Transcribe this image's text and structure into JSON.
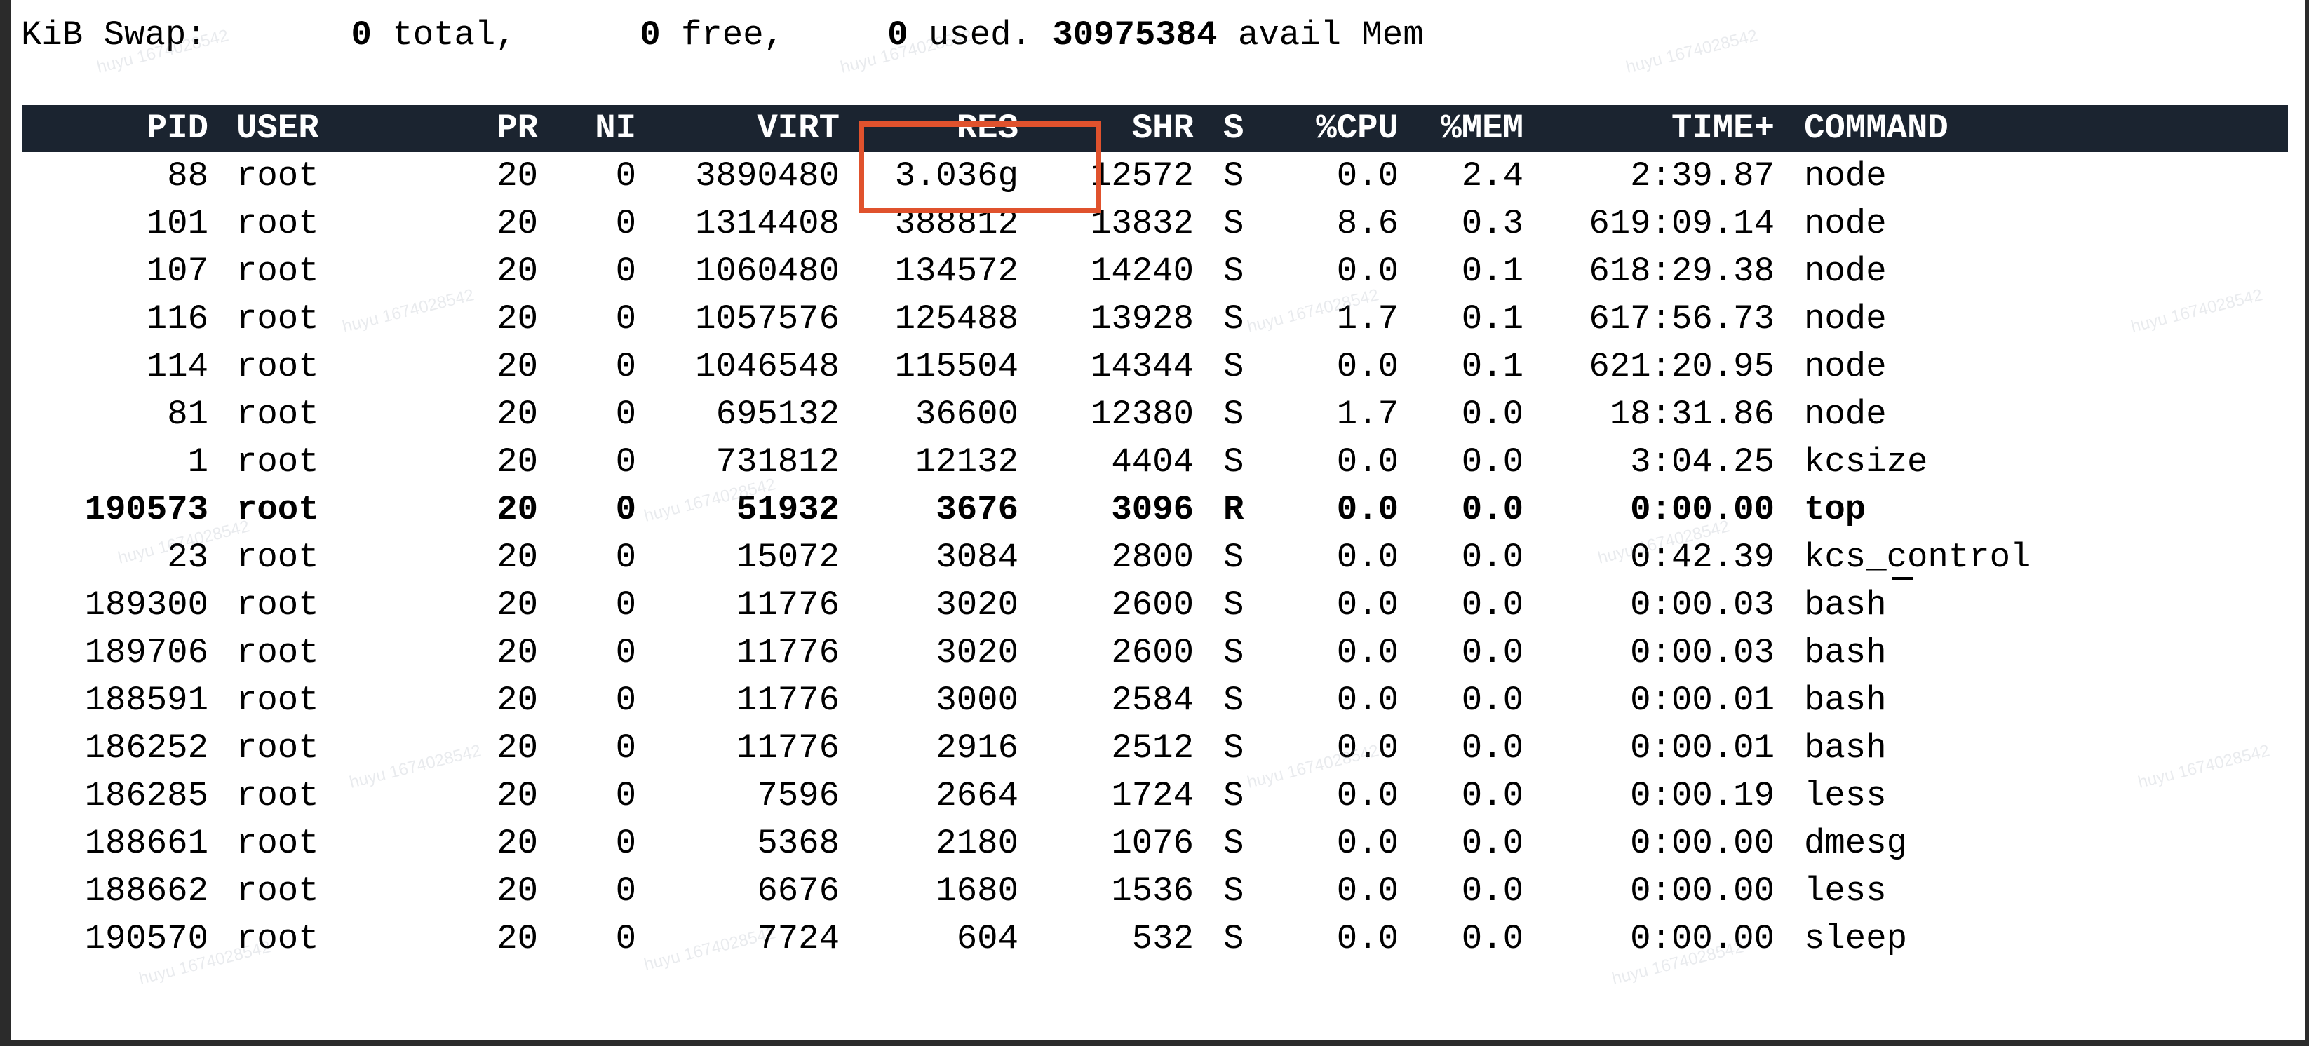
{
  "swap_line": {
    "label": "KiB Swap:",
    "total_value": "0",
    "total_label": "total,",
    "free_value": "0",
    "free_label": "free,",
    "used_value": "0",
    "used_label": "used.",
    "avail_value": "30975384",
    "avail_label": "avail Mem"
  },
  "table": {
    "headers": [
      "PID",
      "USER",
      "PR",
      "NI",
      "VIRT",
      "RES",
      "SHR",
      "S",
      "%CPU",
      "%MEM",
      "TIME+",
      "COMMAND"
    ],
    "rows": [
      [
        "88",
        "root",
        "20",
        "0",
        "3890480",
        "3.036g",
        "12572",
        "S",
        "0.0",
        "2.4",
        "2:39.87",
        "node"
      ],
      [
        "101",
        "root",
        "20",
        "0",
        "1314408",
        "388812",
        "13832",
        "S",
        "8.6",
        "0.3",
        "619:09.14",
        "node"
      ],
      [
        "107",
        "root",
        "20",
        "0",
        "1060480",
        "134572",
        "14240",
        "S",
        "0.0",
        "0.1",
        "618:29.38",
        "node"
      ],
      [
        "116",
        "root",
        "20",
        "0",
        "1057576",
        "125488",
        "13928",
        "S",
        "1.7",
        "0.1",
        "617:56.73",
        "node"
      ],
      [
        "114",
        "root",
        "20",
        "0",
        "1046548",
        "115504",
        "14344",
        "S",
        "0.0",
        "0.1",
        "621:20.95",
        "node"
      ],
      [
        "81",
        "root",
        "20",
        "0",
        "695132",
        "36600",
        "12380",
        "S",
        "1.7",
        "0.0",
        "18:31.86",
        "node"
      ],
      [
        "1",
        "root",
        "20",
        "0",
        "731812",
        "12132",
        "4404",
        "S",
        "0.0",
        "0.0",
        "3:04.25",
        "kcsize"
      ],
      [
        "190573",
        "root",
        "20",
        "0",
        "51932",
        "3676",
        "3096",
        "R",
        "0.0",
        "0.0",
        "0:00.00",
        "top"
      ],
      [
        "23",
        "root",
        "20",
        "0",
        "15072",
        "3084",
        "2800",
        "S",
        "0.0",
        "0.0",
        "0:42.39",
        "kcs_control"
      ],
      [
        "189300",
        "root",
        "20",
        "0",
        "11776",
        "3020",
        "2600",
        "S",
        "0.0",
        "0.0",
        "0:00.03",
        "bash"
      ],
      [
        "189706",
        "root",
        "20",
        "0",
        "11776",
        "3020",
        "2600",
        "S",
        "0.0",
        "0.0",
        "0:00.03",
        "bash"
      ],
      [
        "188591",
        "root",
        "20",
        "0",
        "11776",
        "3000",
        "2584",
        "S",
        "0.0",
        "0.0",
        "0:00.01",
        "bash"
      ],
      [
        "186252",
        "root",
        "20",
        "0",
        "11776",
        "2916",
        "2512",
        "S",
        "0.0",
        "0.0",
        "0:00.01",
        "bash"
      ],
      [
        "186285",
        "root",
        "20",
        "0",
        "7596",
        "2664",
        "1724",
        "S",
        "0.0",
        "0.0",
        "0:00.19",
        "less"
      ],
      [
        "188661",
        "root",
        "20",
        "0",
        "5368",
        "2180",
        "1076",
        "S",
        "0.0",
        "0.0",
        "0:00.00",
        "dmesg"
      ],
      [
        "188662",
        "root",
        "20",
        "0",
        "6676",
        "1680",
        "1536",
        "S",
        "0.0",
        "0.0",
        "0:00.00",
        "less"
      ],
      [
        "190570",
        "root",
        "20",
        "0",
        "7724",
        "604",
        "532",
        "S",
        "0.0",
        "0.0",
        "0:00.00",
        "sleep"
      ]
    ],
    "bold_row_index": 7
  },
  "colors": {
    "header_background": "#1b2430",
    "header_text": "#ffffff",
    "highlight_box": "#e0522d",
    "terminal_background": "#ffffff",
    "text": "#000000"
  }
}
